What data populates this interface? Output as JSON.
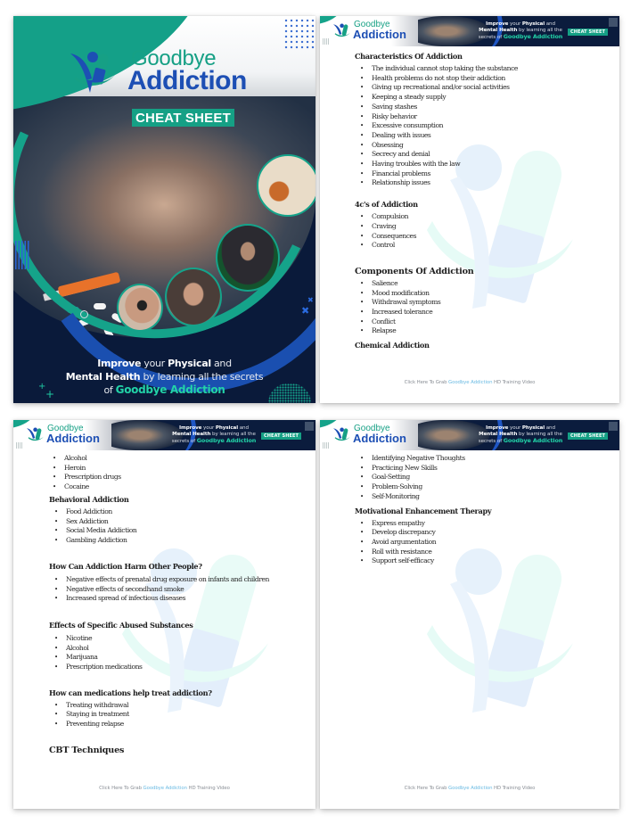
{
  "brand": {
    "name_line1": "Goodbye",
    "name_line2": "Addiction",
    "badge": "CHEAT SHEET",
    "colors": {
      "teal": "#15a085",
      "blue": "#1d4fb4",
      "navy": "#0b1c3d",
      "link": "#6bbbe3"
    }
  },
  "cover": {
    "tagline": {
      "w1": "Improve",
      "w2": " your ",
      "w3": "Physical",
      "w4": " and",
      "w5": "Mental Health",
      "w6": " by learning all the secrets",
      "w7": "of ",
      "w8": "Goodbye Addiction"
    }
  },
  "banner": {
    "w1": "Improve",
    "w2": " your ",
    "w3": "Physical",
    "w4": " and",
    "w5": "Mental Health",
    "w6": " by learning all the",
    "w7": "secrets of ",
    "w8": "Goodbye Addiction",
    "badge": "CHEAT SHEET"
  },
  "footer": {
    "prefix": "Click Here To Grab ",
    "link": "Goodbye Addiction",
    "suffix": " HD Training Video"
  },
  "page2": {
    "sections": [
      {
        "heading": "Characteristics Of Addiction",
        "items": [
          "The individual cannot stop taking the substance",
          "Health problems do not stop their addiction",
          "Giving up recreational and/or social activities",
          "Keeping a steady supply",
          "Saving stashes",
          "Risky behavior",
          "Excessive consumption",
          "Dealing with issues",
          "Obsessing",
          "Secrecy and denial",
          "Having troubles with the law",
          "Financial problems",
          "Relationship issues"
        ]
      },
      {
        "heading": "4c's of Addiction",
        "items": [
          "Compulsion",
          "Craving",
          "Consequences",
          "Control"
        ]
      },
      {
        "heading": "Components Of Addiction",
        "items": [
          "Salience",
          "Mood modification",
          "Withdrawal symptoms",
          "Increased tolerance",
          "Conflict",
          "Relapse"
        ]
      },
      {
        "heading": "Chemical Addiction",
        "items": []
      }
    ]
  },
  "page3": {
    "lead_items": [
      "Alcohol",
      "Heroin",
      "Prescription drugs",
      "Cocaine"
    ],
    "sections": [
      {
        "heading": "Behavioral Addiction",
        "items": [
          "Food Addiction",
          "Sex Addiction",
          "Social Media Addiction",
          "Gambling Addiction"
        ]
      },
      {
        "heading": "How Can Addiction Harm Other People?",
        "items": [
          "Negative effects of prenatal drug exposure on infants and children",
          "Negative effects of secondhand smoke",
          "Increased spread of infectious diseases"
        ]
      },
      {
        "heading": "Effects of Specific Abused Substances",
        "items": [
          "Nicotine",
          "Alcohol",
          "Marijuana",
          "Prescription medications"
        ]
      },
      {
        "heading": "How can medications help treat addiction?",
        "items": [
          "Treating withdrawal",
          "Staying in treatment",
          "Preventing relapse"
        ]
      },
      {
        "heading": "CBT Techniques",
        "items": []
      }
    ]
  },
  "page4": {
    "lead_items": [
      "Identifying Negative Thoughts",
      "Practicing New Skills",
      "Goal-Setting",
      "Problem-Solving",
      "Self-Monitoring"
    ],
    "sections": [
      {
        "heading": "Motivational Enhancement Therapy",
        "items": [
          "Express empathy",
          "Develop discrepancy",
          "Avoid argumentation",
          "Roll with resistance",
          "Support self-efficacy"
        ]
      }
    ]
  }
}
